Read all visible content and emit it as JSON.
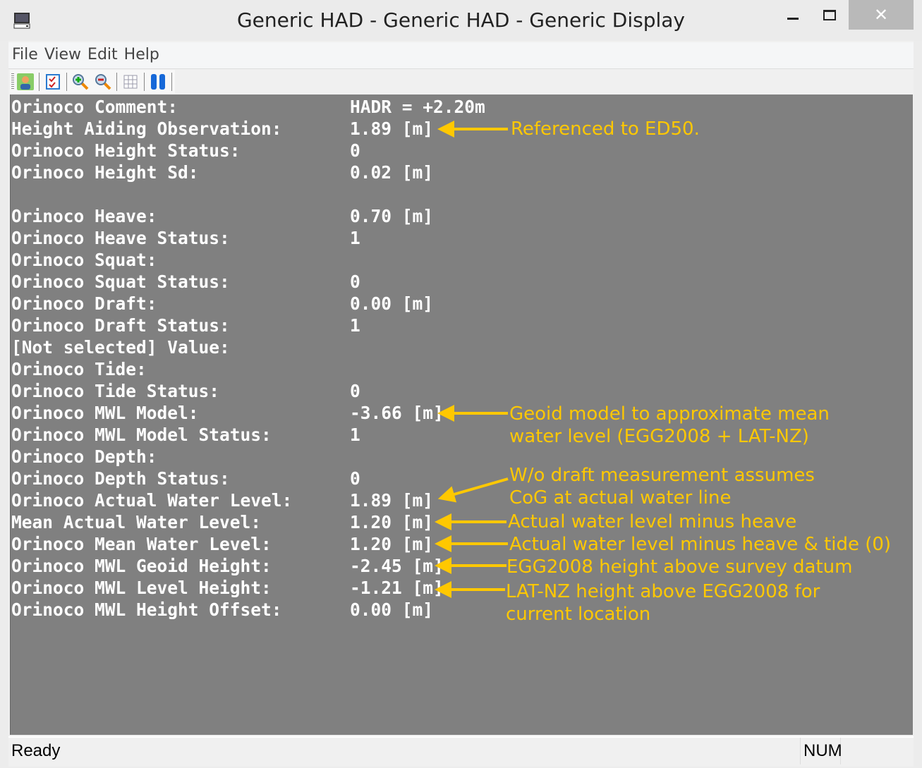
{
  "window": {
    "title": "Generic HAD - Generic HAD  - Generic Display",
    "close": "✕"
  },
  "menu": [
    "File",
    "View",
    "Edit",
    "Help"
  ],
  "toolbar": [
    "user-icon",
    "checklist-icon",
    "zoom-in-icon",
    "zoom-out-icon",
    "grid-icon",
    "pause-icon"
  ],
  "rows": [
    {
      "label": "Orinoco Comment:",
      "value": "HADR = +2.20m"
    },
    {
      "label": "Height Aiding Observation:",
      "value": "1.89 [m]"
    },
    {
      "label": "Orinoco Height Status:",
      "value": "0"
    },
    {
      "label": "Orinoco Height Sd:",
      "value": "0.02 [m]"
    },
    {
      "label": "",
      "value": ""
    },
    {
      "label": "Orinoco Heave:",
      "value": "0.70 [m]"
    },
    {
      "label": "Orinoco Heave Status:",
      "value": "1"
    },
    {
      "label": "Orinoco Squat:",
      "value": ""
    },
    {
      "label": "Orinoco Squat Status:",
      "value": "0"
    },
    {
      "label": "Orinoco Draft:",
      "value": "0.00 [m]"
    },
    {
      "label": "Orinoco Draft Status:",
      "value": "1"
    },
    {
      "label": "[Not selected] Value:",
      "value": ""
    },
    {
      "label": "Orinoco Tide:",
      "value": ""
    },
    {
      "label": "Orinoco Tide Status:",
      "value": "0"
    },
    {
      "label": "Orinoco MWL Model:",
      "value": "-3.66 [m]"
    },
    {
      "label": "Orinoco MWL Model Status:",
      "value": "1"
    },
    {
      "label": "Orinoco Depth:",
      "value": ""
    },
    {
      "label": "Orinoco Depth Status:",
      "value": "0"
    },
    {
      "label": "Orinoco Actual Water Level:",
      "value": "1.89 [m]"
    },
    {
      "label": "Mean Actual Water Level:",
      "value": "1.20 [m]"
    },
    {
      "label": "Orinoco Mean Water Level:",
      "value": "1.20 [m]"
    },
    {
      "label": "Orinoco MWL Geoid Height:",
      "value": "-2.45 [m]"
    },
    {
      "label": "Orinoco MWL Level Height:",
      "value": "-1.21 [m]"
    },
    {
      "label": "Orinoco MWL Height Offset:",
      "value": "0.00 [m]"
    }
  ],
  "annotations": {
    "ed50": "Referenced to ED50.",
    "geoid_1": "Geoid model to approximate mean",
    "geoid_2": "water level (EGG2008 + LAT-NZ)",
    "draft_1": "W/o draft measurement assumes",
    "draft_2": "CoG at actual water line",
    "actual_heave": "Actual water level minus heave",
    "actual_heave_tide": "Actual water level minus heave & tide (0)",
    "egg": "EGG2008 height above survey datum",
    "latnz_1": "LAT-NZ height above EGG2008 for",
    "latnz_2": "current location"
  },
  "annotation_color": "#ffc800",
  "status": {
    "text": "Ready",
    "num": "NUM"
  }
}
